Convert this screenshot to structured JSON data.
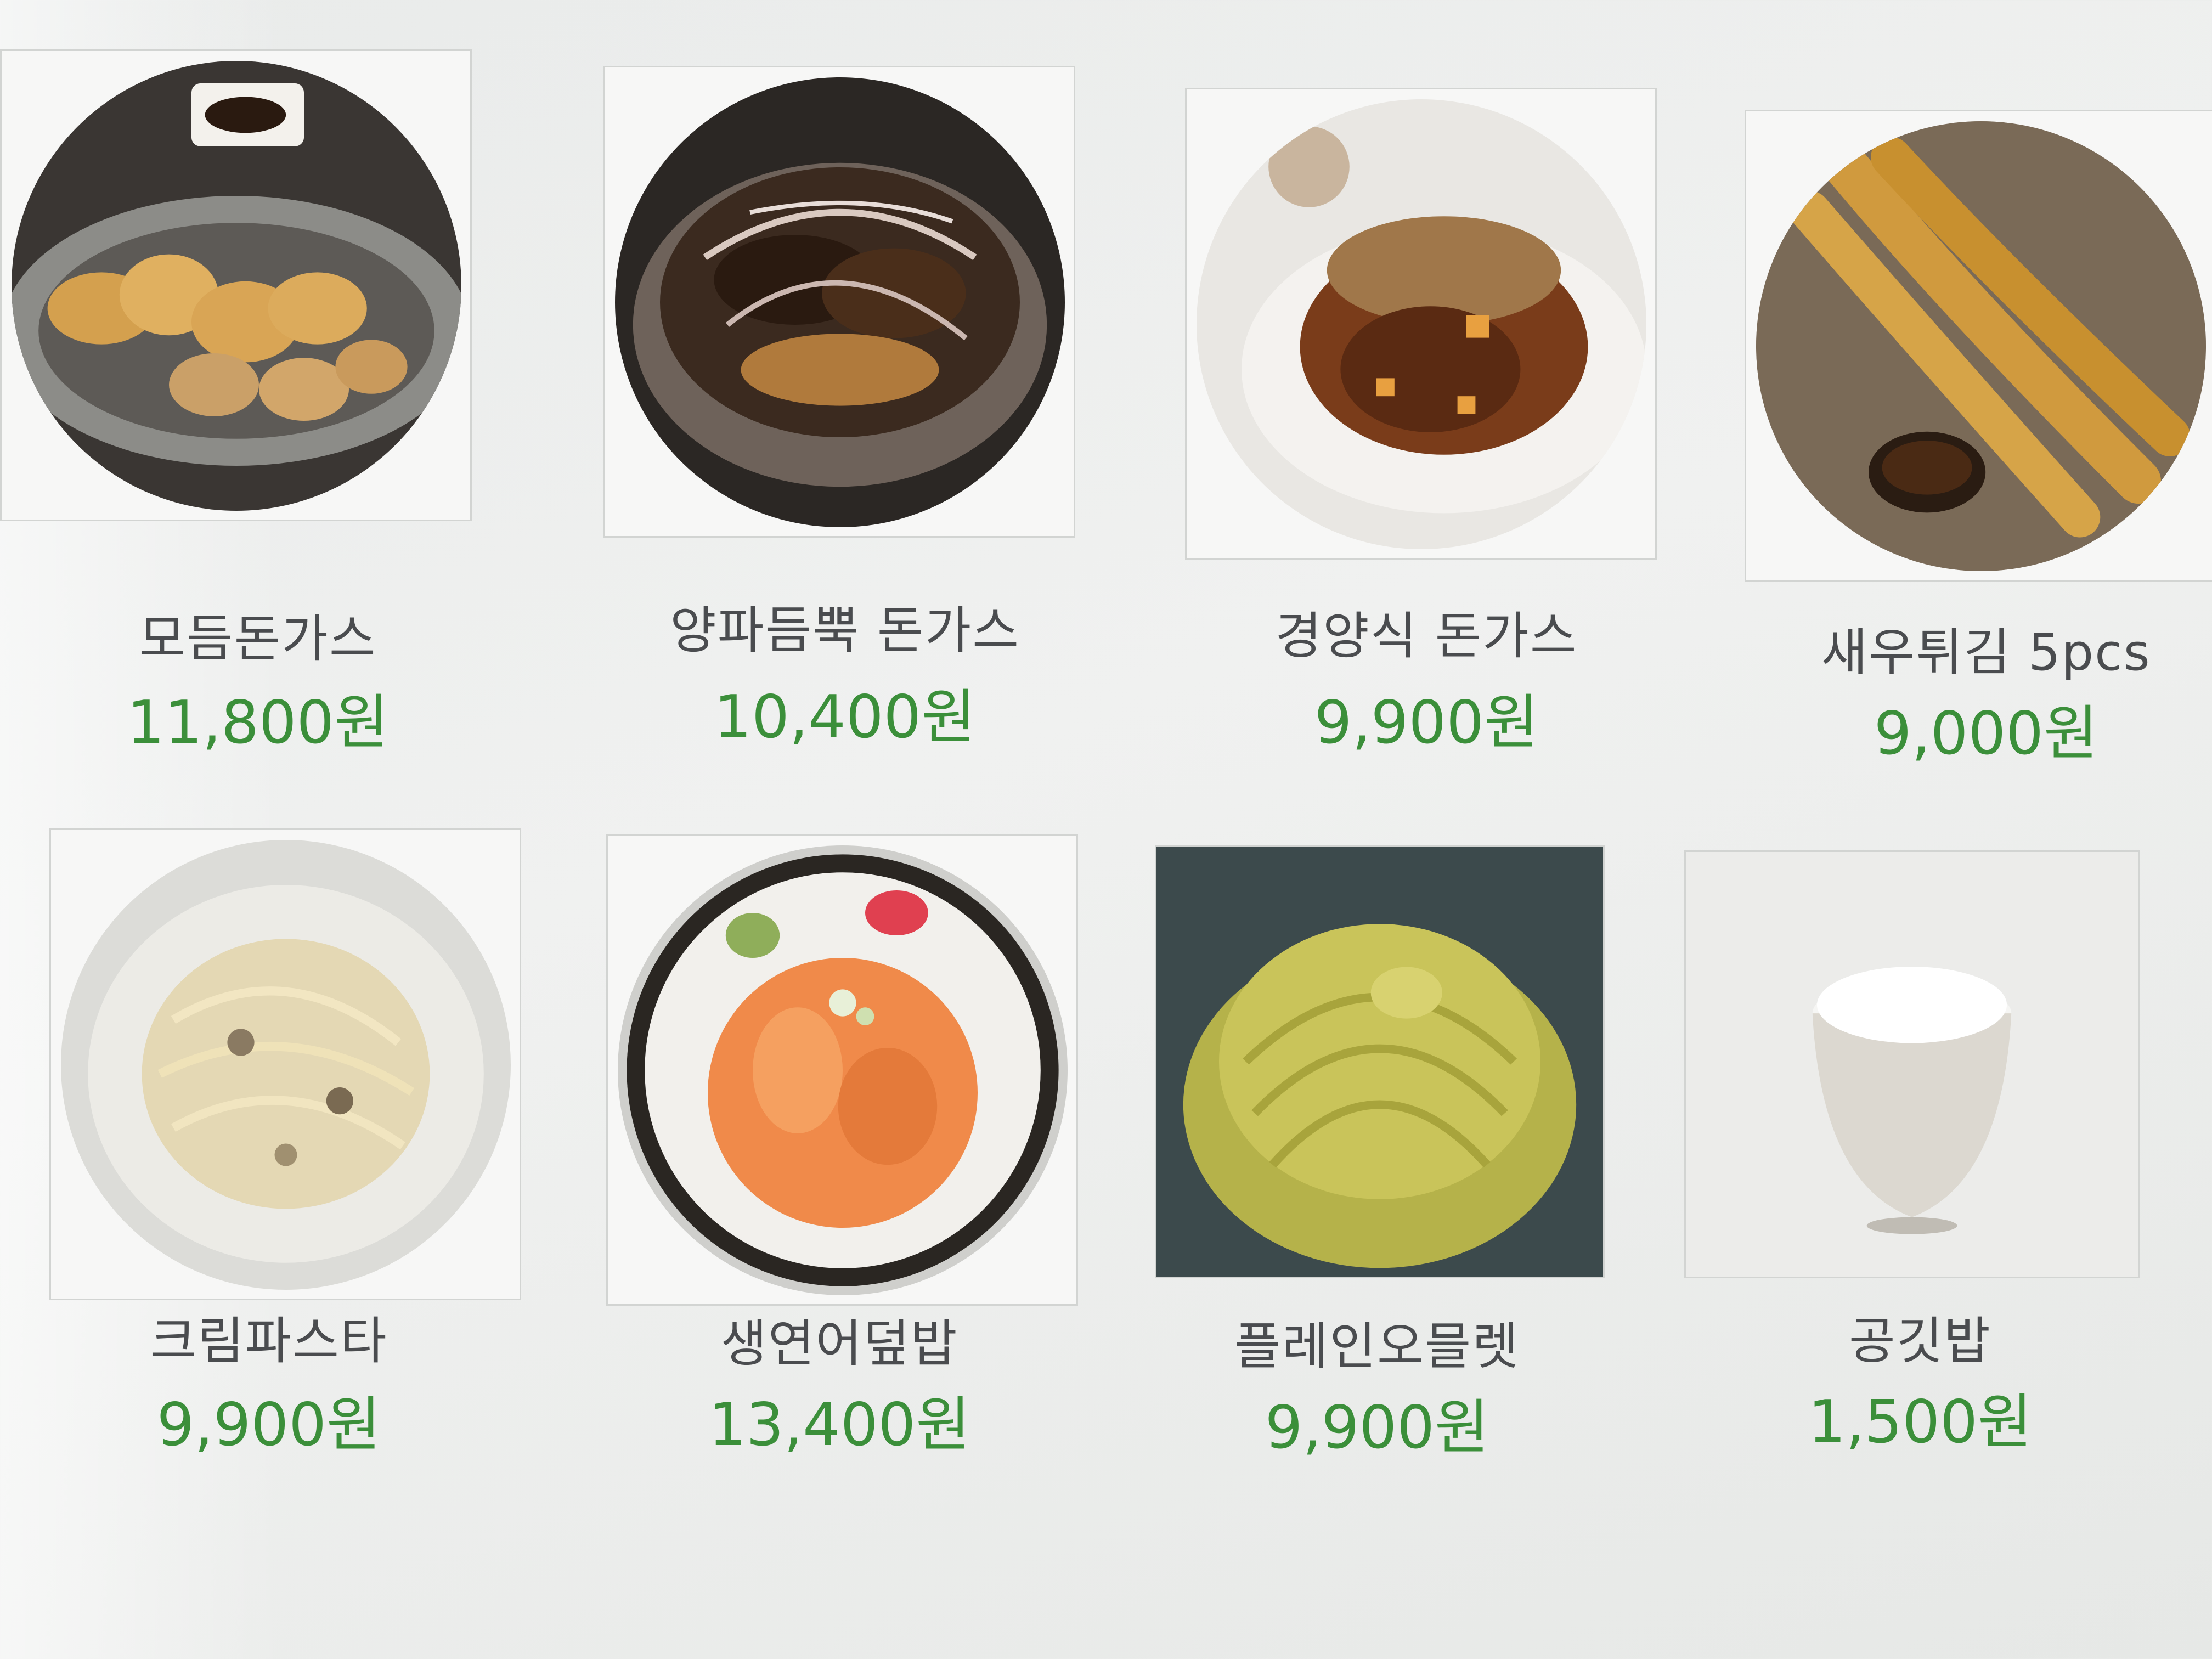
{
  "menu": {
    "items": [
      {
        "name": "모듬돈가스",
        "price": "11,800원",
        "image": "assorted-pork-cutlet-photo"
      },
      {
        "name": "양파듬뿍 돈가스",
        "price": "10,400원",
        "image": "onion-pork-cutlet-photo"
      },
      {
        "name": "경양식 돈가스",
        "price": "9,900원",
        "image": "western-pork-cutlet-photo"
      },
      {
        "name": "새우튀김 5pcs",
        "price": "9,000원",
        "image": "fried-shrimp-photo"
      },
      {
        "name": "크림파스타",
        "price": "9,900원",
        "image": "cream-pasta-photo"
      },
      {
        "name": "생연어덮밥",
        "price": "13,400원",
        "image": "salmon-rice-bowl-photo"
      },
      {
        "name": "플레인오믈렛",
        "price": "9,900원",
        "image": "plain-omelette-photo"
      },
      {
        "name": "공깃밥",
        "price": "1,500원",
        "image": "rice-bowl-photo"
      }
    ]
  },
  "colors": {
    "price": "#3b8f3a",
    "name": "#4a4c4f",
    "background": "#eceeed"
  }
}
